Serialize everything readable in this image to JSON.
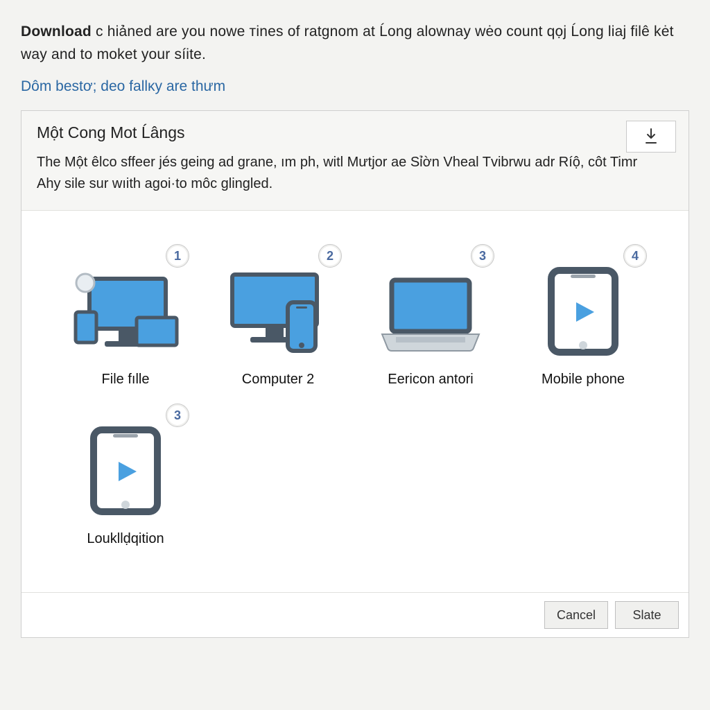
{
  "intro": {
    "bold": "Download",
    "rest": " ᴄ hiảned are you nowe тines of ratgnom at Ĺong alownay wėo count qọj Ĺong liaj filê kėt way and to moket your síite."
  },
  "link_text": "Dôm bestơ; deo fallᴋy are thưm",
  "panel": {
    "title": "Một Cong Mot Ĺângs",
    "description": "The Một êlco sffeer jés geing ad grane, ım ph, witl Mưtjor ae Sỉờn Vheal Tvibrwu adr Ríộ, côt Timr Ahy sile sur wıith agoi·to môc glingled.",
    "download_icon_name": "download-icon"
  },
  "options": [
    {
      "badge": "1",
      "label": "File fılle",
      "icon": "devices-icon"
    },
    {
      "badge": "2",
      "label": "Computer 2",
      "icon": "desktop-phone-icon"
    },
    {
      "badge": "3",
      "label": "Eericon antori",
      "icon": "laptop-icon"
    },
    {
      "badge": "4",
      "label": "Mobile phone",
      "icon": "tablet-play-icon"
    },
    {
      "badge": "3",
      "label": "Loukllḍqition",
      "icon": "tablet-play-icon"
    }
  ],
  "buttons": {
    "cancel": "Cancel",
    "primary": "Slate"
  },
  "colors": {
    "accent_blue": "#4aa0e0",
    "device_dark": "#4a5866",
    "badge_text": "#4a6aa0"
  }
}
